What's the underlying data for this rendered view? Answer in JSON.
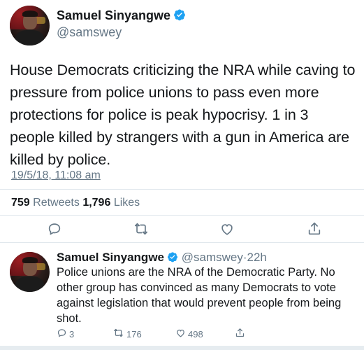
{
  "main_tweet": {
    "author_name": "Samuel Sinyangwe",
    "handle": "@samswey",
    "text": "House Democrats criticizing the NRA while caving to pressure from police unions to pass even more protections for police is peak hypocrisy. 1 in 3 people killed by strangers with a gun in America are killed by police.",
    "timestamp": "19/5/18, 11:08 am",
    "retweets_count": "759",
    "retweets_label": "Retweets",
    "likes_count": "1,796",
    "likes_label": "Likes",
    "icons": [
      "reply-icon",
      "retweet-icon",
      "like-icon",
      "share-icon"
    ]
  },
  "reply_tweet": {
    "author_name": "Samuel Sinyangwe",
    "handle": "@samswey",
    "separator": "·",
    "age": "22h",
    "text": "Police unions are the NRA of the Democratic Party. No other group has convinced as many Democrats to vote against legislation that would prevent people from being shot.",
    "reply_count": "3",
    "retweet_count": "176",
    "like_count": "498"
  },
  "colors": {
    "text": "#14171a",
    "secondary": "#657786",
    "verified": "#1da1f2",
    "divider": "#e1e8ed"
  }
}
